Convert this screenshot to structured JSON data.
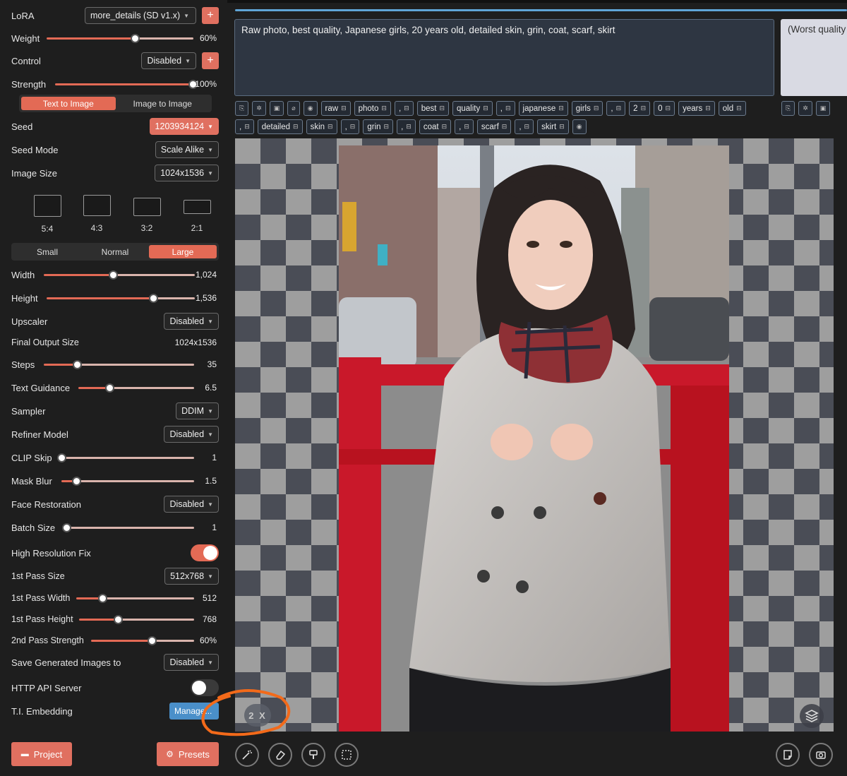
{
  "sidebar": {
    "lora_label": "LoRA",
    "lora_model": "more_details (SD v1.x)",
    "weight": {
      "label": "Weight",
      "value": "60%",
      "fraction": 0.6
    },
    "control": {
      "label": "Control",
      "value": "Disabled"
    },
    "strength": {
      "label": "Strength",
      "value": "100%",
      "fraction": 1.0
    },
    "mode_tabs": [
      {
        "label": "Text to Image",
        "active": true
      },
      {
        "label": "Image to Image",
        "active": false
      }
    ],
    "seed": {
      "label": "Seed",
      "value": "1203934124"
    },
    "seed_mode": {
      "label": "Seed Mode",
      "value": "Scale Alike"
    },
    "image_size": {
      "label": "Image Size",
      "value": "1024x1536"
    },
    "ratios": [
      "5:4",
      "4:3",
      "3:2",
      "2:1"
    ],
    "size_tabs": [
      {
        "label": "Small",
        "active": false
      },
      {
        "label": "Normal",
        "active": false
      },
      {
        "label": "Large",
        "active": true
      }
    ],
    "width": {
      "label": "Width",
      "value": "1,024",
      "fraction": 0.45
    },
    "height": {
      "label": "Height",
      "value": "1,536",
      "fraction": 0.72
    },
    "upscaler": {
      "label": "Upscaler",
      "value": "Disabled"
    },
    "final_output": {
      "label": "Final Output Size",
      "value": "1024x1536"
    },
    "steps": {
      "label": "Steps",
      "value": "35",
      "fraction": 0.22
    },
    "text_guidance": {
      "label": "Text Guidance",
      "value": "6.5",
      "fraction": 0.27
    },
    "sampler": {
      "label": "Sampler",
      "value": "DDIM"
    },
    "refiner": {
      "label": "Refiner Model",
      "value": "Disabled"
    },
    "clip_skip": {
      "label": "CLIP Skip",
      "value": "1",
      "fraction": 0.0
    },
    "mask_blur": {
      "label": "Mask Blur",
      "value": "1.5",
      "fraction": 0.11
    },
    "face_restoration": {
      "label": "Face Restoration",
      "value": "Disabled"
    },
    "batch_size": {
      "label": "Batch Size",
      "value": "1",
      "fraction": 0.0
    },
    "hires_fix": {
      "label": "High Resolution Fix",
      "on": true
    },
    "first_pass_size": {
      "label": "1st Pass Size",
      "value": "512x768"
    },
    "first_pass_width": {
      "label": "1st Pass Width",
      "value": "512",
      "fraction": 0.21
    },
    "first_pass_height": {
      "label": "1st Pass Height",
      "value": "768",
      "fraction": 0.44
    },
    "second_pass_strength": {
      "label": "2nd Pass Strength",
      "value": "60%",
      "fraction": 0.59
    },
    "save_images": {
      "label": "Save Generated Images to",
      "value": "Disabled"
    },
    "http_api": {
      "label": "HTTP API Server",
      "on": false
    },
    "ti_embedding": {
      "label": "T.I. Embedding",
      "button": "Manage..."
    },
    "project_button": "Project",
    "presets_button": "Presets"
  },
  "prompt": {
    "positive": "Raw photo, best quality, Japanese girls, 20 years old, detailed skin, grin, coat, scarf, skirt",
    "negative": "(Worst quality"
  },
  "tag_row_1": [
    "raw",
    "photo",
    ",",
    "best",
    "quality",
    ",",
    "japanese",
    "girls",
    ",",
    "2",
    "0",
    "years",
    "old"
  ],
  "tag_row_2": [
    ",",
    "detailed",
    "skin",
    ",",
    "grin",
    ",",
    "coat",
    ",",
    "scarf",
    ",",
    "skirt"
  ],
  "canvas": {
    "zoom_label": "2 X"
  },
  "colors": {
    "accent": "#e36a55",
    "link_blue": "#4a8fc9",
    "prompt_bg": "#2e3642"
  }
}
